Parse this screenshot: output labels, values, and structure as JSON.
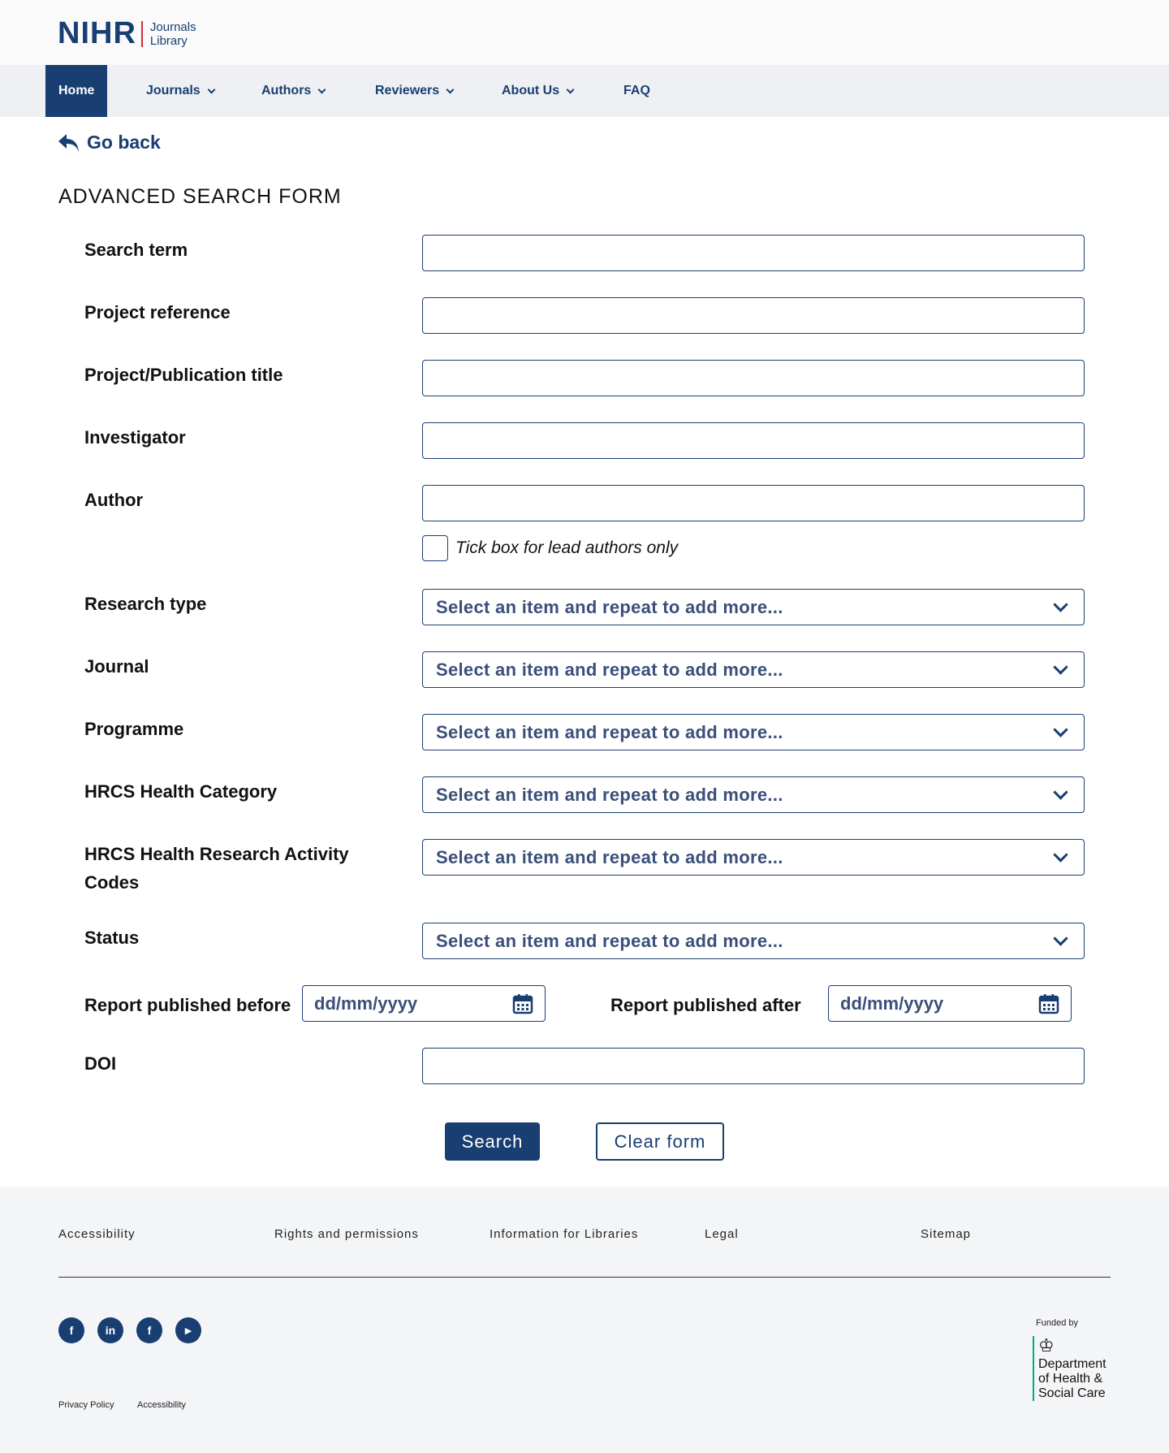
{
  "logo": {
    "brand": "NIHR",
    "sub_line1": "Journals",
    "sub_line2": "Library"
  },
  "nav": {
    "items": [
      {
        "label": "Home",
        "active": true,
        "dropdown": false
      },
      {
        "label": "Journals",
        "dropdown": true
      },
      {
        "label": "Authors",
        "dropdown": true
      },
      {
        "label": "Reviewers",
        "dropdown": true
      },
      {
        "label": "About Us",
        "dropdown": true
      },
      {
        "label": "FAQ",
        "dropdown": false
      }
    ]
  },
  "goback": {
    "label": "Go back"
  },
  "form": {
    "title": "ADVANCED SEARCH FORM",
    "search_term": {
      "label": "Search term",
      "value": ""
    },
    "project_reference": {
      "label": "Project reference",
      "value": ""
    },
    "publication_title": {
      "label": "Project/Publication title",
      "value": ""
    },
    "investigator": {
      "label": "Investigator",
      "value": ""
    },
    "author": {
      "label": "Author",
      "value": ""
    },
    "lead_authors": {
      "label": "Tick box for lead authors only",
      "checked": false
    },
    "select_placeholder": "Select an item and repeat to add more...",
    "research_type": {
      "label": "Research type"
    },
    "journal": {
      "label": "Journal"
    },
    "programme": {
      "label": "Programme"
    },
    "hrcs_category": {
      "label": "HRCS Health Category"
    },
    "hrcs_activity_line1": "HRCS Health Research Activity",
    "hrcs_activity_line2": "Codes",
    "status": {
      "label": "Status"
    },
    "published_before": {
      "label": "Report published before",
      "placeholder": "dd/mm/yyyy"
    },
    "published_after": {
      "label": "Report published after",
      "placeholder": "dd/mm/yyyy"
    },
    "doi": {
      "label": "DOI",
      "value": ""
    },
    "search_button": "Search",
    "clear_button": "Clear form"
  },
  "footer": {
    "links": [
      "Accessibility",
      "Rights and permissions",
      "Information for Libraries",
      "Legal",
      "Sitemap"
    ],
    "social": [
      {
        "icon": "facebook-icon",
        "glyph": "f"
      },
      {
        "icon": "linkedin-icon",
        "glyph": "in"
      },
      {
        "icon": "facebook-icon",
        "glyph": "f"
      },
      {
        "icon": "youtube-icon",
        "glyph": "▶"
      }
    ],
    "bottom_links": [
      "Privacy Policy",
      "Accessibility"
    ],
    "funded_by": "Funded by",
    "dhsc_line1": "Department",
    "dhsc_line2": "of Health &",
    "dhsc_line3": "Social Care"
  },
  "colors": {
    "brand_navy": "#193e72",
    "accent_red": "#d42a3c",
    "dhsc_green": "#00a88e"
  }
}
